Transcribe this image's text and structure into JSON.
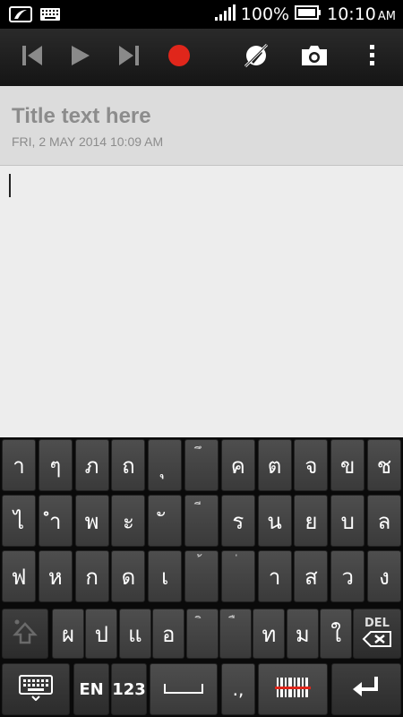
{
  "status_bar": {
    "battery_percent": "100%",
    "time": "10:10",
    "ampm": "AM",
    "icons": [
      "notes-notification-icon",
      "keyboard-notification-icon",
      "signal-icon",
      "battery-icon"
    ]
  },
  "toolbar": {
    "buttons": [
      "skip-previous-icon",
      "play-icon",
      "skip-next-icon",
      "record-icon",
      "pen-off-icon",
      "camera-icon",
      "overflow-menu-icon"
    ],
    "record_color": "#e0261b"
  },
  "note": {
    "title_placeholder": "Title text here",
    "datetime": "FRI, 2 MAY 2014 10:09 AM"
  },
  "keyboard": {
    "row1": [
      {
        "main": "า",
        "sec": ""
      },
      {
        "main": "ๆ",
        "sec": ""
      },
      {
        "main": "ภ",
        "sec": ""
      },
      {
        "main": "ถ",
        "sec": ""
      },
      {
        "main": "ุ",
        "sec": ""
      },
      {
        "main": "",
        "sec": "ึ"
      },
      {
        "main": "ค",
        "sec": ""
      },
      {
        "main": "ต",
        "sec": ""
      },
      {
        "main": "จ",
        "sec": ""
      },
      {
        "main": "ข",
        "sec": ""
      },
      {
        "main": "ช",
        "sec": ""
      }
    ],
    "row2": [
      {
        "main": "ไ",
        "sec": ""
      },
      {
        "main": "ำ",
        "sec": ""
      },
      {
        "main": "พ",
        "sec": ""
      },
      {
        "main": "ะ",
        "sec": ""
      },
      {
        "main": "ั",
        "sec": ""
      },
      {
        "main": "",
        "sec": "ี"
      },
      {
        "main": "ร",
        "sec": ""
      },
      {
        "main": "น",
        "sec": ""
      },
      {
        "main": "ย",
        "sec": ""
      },
      {
        "main": "บ",
        "sec": ""
      },
      {
        "main": "ล",
        "sec": ""
      }
    ],
    "row3": [
      {
        "main": "ฟ",
        "sec": ""
      },
      {
        "main": "ห",
        "sec": ""
      },
      {
        "main": "ก",
        "sec": ""
      },
      {
        "main": "ด",
        "sec": ""
      },
      {
        "main": "เ",
        "sec": ""
      },
      {
        "main": "",
        "sec": "้"
      },
      {
        "main": "",
        "sec": "่"
      },
      {
        "main": "า",
        "sec": ""
      },
      {
        "main": "ส",
        "sec": ""
      },
      {
        "main": "ว",
        "sec": ""
      },
      {
        "main": "ง",
        "sec": ""
      }
    ],
    "row4": [
      {
        "main": "ผ",
        "sec": ""
      },
      {
        "main": "ป",
        "sec": ""
      },
      {
        "main": "แ",
        "sec": ""
      },
      {
        "main": "อ",
        "sec": ""
      },
      {
        "main": "",
        "sec": "ิ"
      },
      {
        "main": "",
        "sec": "ื"
      },
      {
        "main": "ท",
        "sec": ""
      },
      {
        "main": "ม",
        "sec": ""
      },
      {
        "main": "ใ",
        "sec": ""
      }
    ],
    "del_label": "DEL",
    "lang_label": "EN",
    "num_label": "123",
    "punct_label": ".,"
  }
}
